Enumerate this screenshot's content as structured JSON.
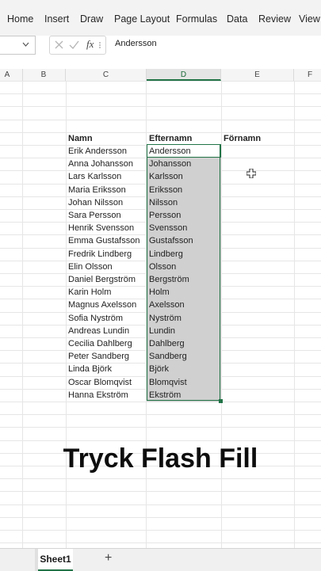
{
  "ribbon": {
    "tabs": [
      "Home",
      "Insert",
      "Draw",
      "Page Layout",
      "Formulas",
      "Data",
      "Review",
      "View"
    ]
  },
  "formula_bar": {
    "content": "Andersson",
    "fx_label": "fx"
  },
  "columns": [
    "A",
    "B",
    "C",
    "D",
    "E",
    "F"
  ],
  "headers": {
    "c": "Namn",
    "d": "Efternamn",
    "e": "Förnamn"
  },
  "rows": [
    {
      "namn": "Erik Andersson",
      "efternamn": "Andersson"
    },
    {
      "namn": "Anna Johansson",
      "efternamn": "Johansson"
    },
    {
      "namn": "Lars Karlsson",
      "efternamn": "Karlsson"
    },
    {
      "namn": "Maria Eriksson",
      "efternamn": "Eriksson"
    },
    {
      "namn": "Johan Nilsson",
      "efternamn": "Nilsson"
    },
    {
      "namn": "Sara Persson",
      "efternamn": "Persson"
    },
    {
      "namn": "Henrik Svensson",
      "efternamn": "Svensson"
    },
    {
      "namn": "Emma Gustafsson",
      "efternamn": "Gustafsson"
    },
    {
      "namn": "Fredrik Lindberg",
      "efternamn": "Lindberg"
    },
    {
      "namn": "Elin Olsson",
      "efternamn": "Olsson"
    },
    {
      "namn": "Daniel Bergström",
      "efternamn": "Bergström"
    },
    {
      "namn": "Karin Holm",
      "efternamn": "Holm"
    },
    {
      "namn": "Magnus Axelsson",
      "efternamn": "Axelsson"
    },
    {
      "namn": "Sofia Nyström",
      "efternamn": "Nyström"
    },
    {
      "namn": "Andreas Lundin",
      "efternamn": "Lundin"
    },
    {
      "namn": "Cecilia Dahlberg",
      "efternamn": "Dahlberg"
    },
    {
      "namn": "Peter Sandberg",
      "efternamn": "Sandberg"
    },
    {
      "namn": "Linda Björk",
      "efternamn": "Björk"
    },
    {
      "namn": "Oscar Blomqvist",
      "efternamn": "Blomqvist"
    },
    {
      "namn": "Hanna Ekström",
      "efternamn": "Ekström"
    }
  ],
  "caption": "Tryck Flash Fill",
  "sheets": {
    "active": "Sheet1",
    "add": "+"
  },
  "colors": {
    "accent": "#217346",
    "selection_fill": "#d0d0d0"
  }
}
